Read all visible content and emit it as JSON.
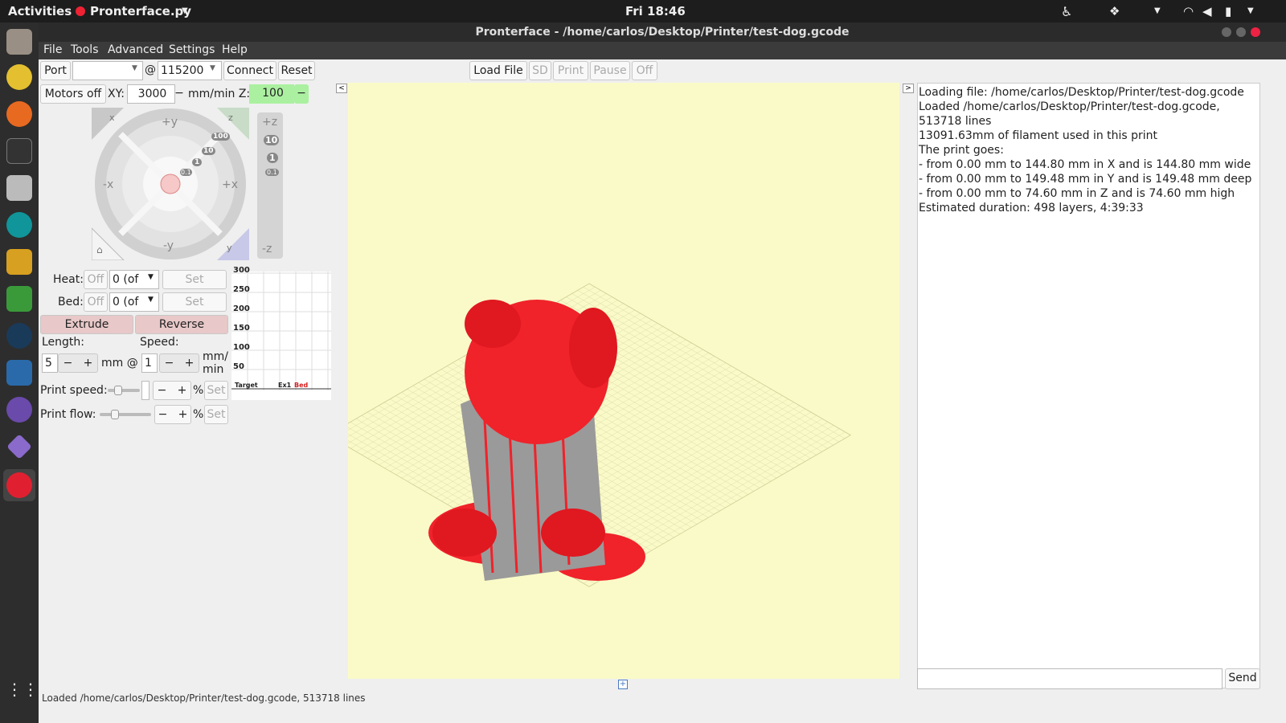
{
  "topbar": {
    "activities": "Activities",
    "app": "Pronterface.py",
    "clock": "Fri 18:46"
  },
  "window": {
    "title": "Pronterface - /home/carlos/Desktop/Printer/test-dog.gcode"
  },
  "menu": [
    "File",
    "Tools",
    "Advanced",
    "Settings",
    "Help"
  ],
  "toolbar": {
    "port_label": "Port",
    "port_value": "",
    "at": "@",
    "baud_value": "115200",
    "connect": "Connect",
    "reset": "Reset",
    "load_file": "Load File",
    "sd": "SD",
    "print": "Print",
    "pause": "Pause",
    "off": "Off"
  },
  "motion": {
    "motors_off": "Motors off",
    "xy_label": "XY:",
    "xy_value": "3000",
    "feed_unit": "mm/min Z:",
    "z_value": "100",
    "minus": "−"
  },
  "jog": {
    "plus_y": "+y",
    "minus_y": "-y",
    "plus_x": "+x",
    "minus_x": "-x",
    "home_x": "x",
    "home_z": "z",
    "home_y": "y",
    "plus_z": "+z",
    "minus_z": "-z",
    "steps": [
      "100",
      "10",
      "1",
      "0.1"
    ]
  },
  "temp": {
    "heat_label": "Heat:",
    "bed_label": "Bed:",
    "off": "Off",
    "heat_value": "0 (of",
    "bed_value": "0 (of",
    "set": "Set"
  },
  "extrude": {
    "extrude": "Extrude",
    "reverse": "Reverse",
    "length_label": "Length:",
    "speed_label": "Speed:",
    "length_value": "5",
    "speed_value": "1",
    "mm_at": "mm @",
    "mm_min": "mm/\nmin"
  },
  "speed": {
    "print_speed_label": "Print speed:",
    "print_flow_label": "Print flow:",
    "pct": "%",
    "set": "Set",
    "minus": "−",
    "plus": "+"
  },
  "graph": {
    "ticks": [
      "300",
      "250",
      "200",
      "150",
      "100",
      "50"
    ],
    "legend": [
      "Target",
      "Ex1",
      "Bed"
    ],
    "legend_colors": [
      "#222222",
      "#222222",
      "#d42020"
    ]
  },
  "log": {
    "lines": [
      "Loading file: /home/carlos/Desktop/Printer/test-dog.gcode",
      "Loaded /home/carlos/Desktop/Printer/test-dog.gcode,",
      "513718 lines",
      "13091.63mm of filament used in this print",
      "The print goes:",
      "- from 0.00 mm to 144.80 mm in X and is 144.80 mm wide",
      "- from 0.00 mm to 149.48 mm in Y and is 149.48 mm deep",
      "- from 0.00 mm to 74.60 mm in Z and is 74.60 mm high",
      "Estimated duration: 498 layers, 4:39:33"
    ],
    "send": "Send",
    "input": ""
  },
  "status": "Loaded /home/carlos/Desktop/Printer/test-dog.gcode, 513718 lines",
  "colors": {
    "model_red": "#f0222a",
    "z_field": "#aaf0a0",
    "extrude_btn": "#e8c8c8"
  }
}
